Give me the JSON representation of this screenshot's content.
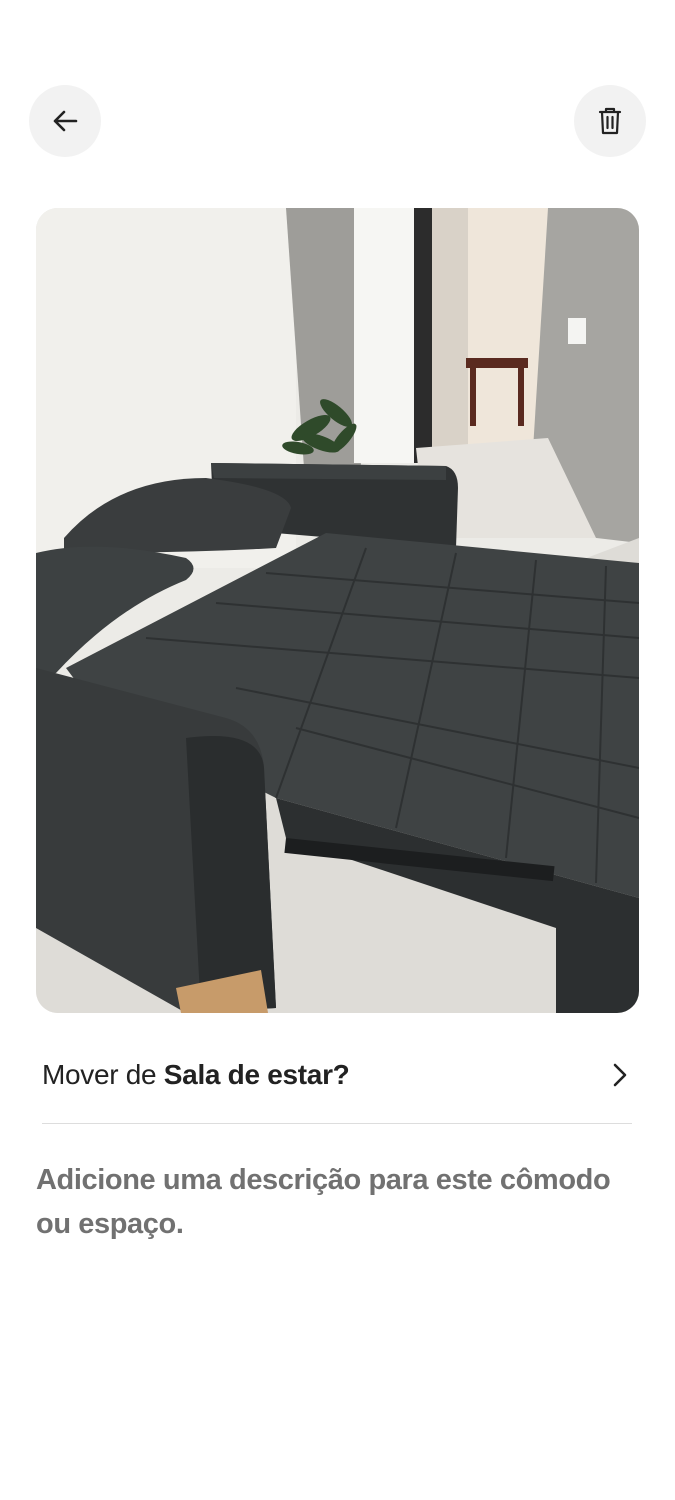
{
  "header": {
    "back_icon": "arrow-left-icon",
    "delete_icon": "trash-icon"
  },
  "photo": {
    "subject": "dark gray leather sofa bed in living room"
  },
  "move": {
    "prefix": "Mover de ",
    "room": "Sala de estar",
    "suffix": "?",
    "chevron_icon": "chevron-right-icon"
  },
  "description": {
    "placeholder": "Adicione uma descrição para este cômodo ou espaço."
  },
  "colors": {
    "button_bg": "#f2f2f2",
    "text_primary": "#222222",
    "text_secondary": "#717171",
    "divider": "#dddddd"
  }
}
